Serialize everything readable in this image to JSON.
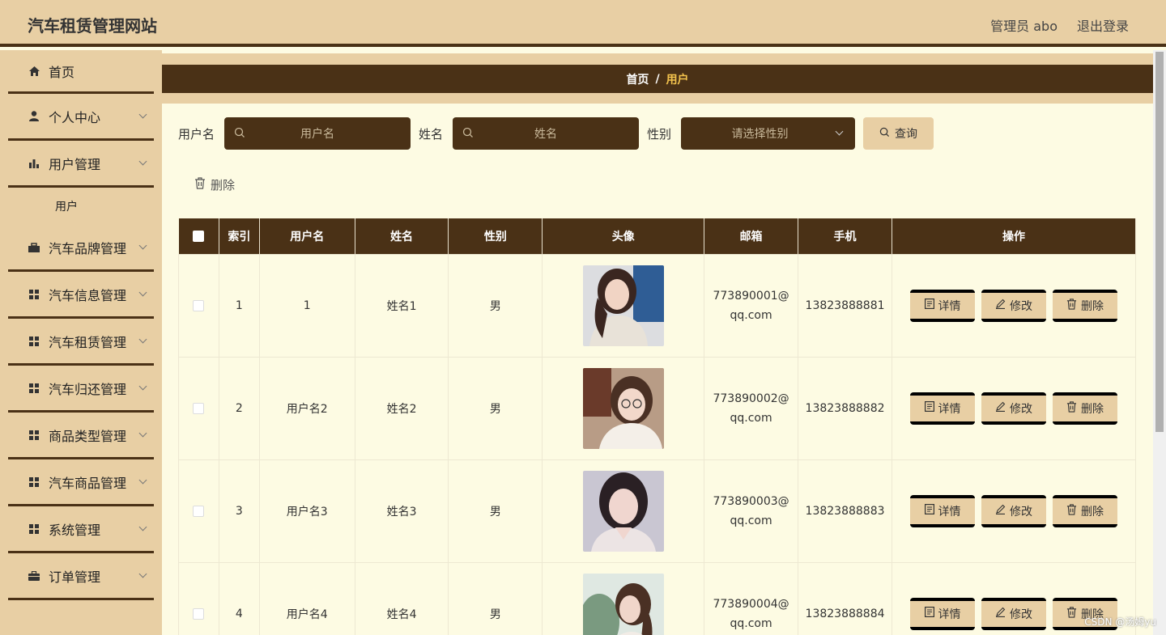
{
  "app": {
    "title": "汽车租赁管理网站"
  },
  "header": {
    "admin_label": "管理员 abo",
    "logout_label": "退出登录"
  },
  "sidebar": {
    "items": [
      {
        "label": "首页",
        "icon": "home-icon"
      },
      {
        "label": "个人中心",
        "icon": "user-icon"
      },
      {
        "label": "用户管理",
        "icon": "bar-chart-icon"
      },
      {
        "label": "用户",
        "icon": ""
      },
      {
        "label": "汽车品牌管理",
        "icon": "briefcase-icon"
      },
      {
        "label": "汽车信息管理",
        "icon": "grid-icon"
      },
      {
        "label": "汽车租赁管理",
        "icon": "grid-icon"
      },
      {
        "label": "汽车归还管理",
        "icon": "grid-icon"
      },
      {
        "label": "商品类型管理",
        "icon": "grid-icon"
      },
      {
        "label": "汽车商品管理",
        "icon": "grid-icon"
      },
      {
        "label": "系统管理",
        "icon": "grid-icon"
      },
      {
        "label": "订单管理",
        "icon": "bag-icon"
      }
    ]
  },
  "breadcrumb": {
    "home": "首页",
    "separator": "/",
    "current": "用户"
  },
  "filters": {
    "username_label": "用户名",
    "username_placeholder": "用户名",
    "name_label": "姓名",
    "name_placeholder": "姓名",
    "gender_label": "性别",
    "gender_placeholder": "请选择性别",
    "query_label": "查询"
  },
  "actions": {
    "delete_label": "删除"
  },
  "table": {
    "headers": [
      "索引",
      "用户名",
      "姓名",
      "性别",
      "头像",
      "邮箱",
      "手机",
      "操作"
    ],
    "rows": [
      {
        "index": "1",
        "username": "1",
        "name": "姓名1",
        "gender": "男",
        "email_a": "773890001@",
        "email_b": "qq.com",
        "phone": "13823888881"
      },
      {
        "index": "2",
        "username": "用户名2",
        "name": "姓名2",
        "gender": "男",
        "email_a": "773890002@",
        "email_b": "qq.com",
        "phone": "13823888882"
      },
      {
        "index": "3",
        "username": "用户名3",
        "name": "姓名3",
        "gender": "男",
        "email_a": "773890003@",
        "email_b": "qq.com",
        "phone": "13823888883"
      },
      {
        "index": "4",
        "username": "用户名4",
        "name": "姓名4",
        "gender": "男",
        "email_a": "773890004@",
        "email_b": "qq.com",
        "phone": "13823888884"
      }
    ],
    "op_labels": {
      "detail": "详情",
      "edit": "修改",
      "delete": "删除"
    }
  },
  "watermark": "CSDN @汤姆yu",
  "colors": {
    "primary_dark": "#4a3116",
    "tan": "#e8cfa4",
    "background": "#fdfbe3",
    "breadcrumb_active": "#f3c34d"
  }
}
